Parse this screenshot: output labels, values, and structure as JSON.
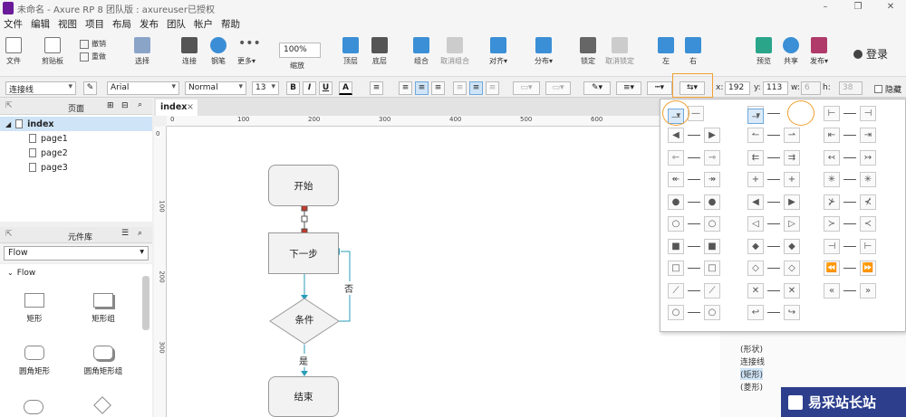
{
  "window": {
    "title": "未命名 - Axure RP 8 团队版 : axureuser已授权",
    "min": "–",
    "restore": "❐",
    "close": "✕"
  },
  "menu": [
    "文件",
    "编辑",
    "视图",
    "项目",
    "布局",
    "发布",
    "团队",
    "帐户",
    "帮助"
  ],
  "toolbar": {
    "file": "文件",
    "clipboard": "剪贴板",
    "undo": "撤销",
    "redo": "重做",
    "select": "选择",
    "connect": "连接",
    "pen": "钢笔",
    "more": "更多▾",
    "zoom": "100%",
    "zoom_label": "缩放",
    "top": "顶层",
    "bottom": "底层",
    "group": "组合",
    "ungroup": "取消组合",
    "align": "对齐▾",
    "distribute": "分布▾",
    "lock": "锁定",
    "unlock": "取消锁定",
    "left": "左",
    "right": "右",
    "preview": "预览",
    "share": "共享",
    "publish": "发布▾",
    "login": "登录"
  },
  "format": {
    "style": "连接线",
    "font": "Arial",
    "weight": "Normal",
    "size": "13",
    "bold": "B",
    "italic": "I",
    "underline": "U",
    "font_color": "A",
    "x_label": "x:",
    "x": "192",
    "y_label": "y:",
    "y": "113",
    "w_label": "w:",
    "w": "6",
    "h_label": "h:",
    "h": "38",
    "hidden": "隐藏"
  },
  "pages_panel": {
    "title": "页面",
    "items": [
      {
        "label": "index"
      },
      {
        "label": "page1"
      },
      {
        "label": "page2"
      },
      {
        "label": "page3"
      }
    ]
  },
  "library_panel": {
    "title": "元件库",
    "selected": "Flow",
    "section": "Flow",
    "items": [
      {
        "label": "矩形"
      },
      {
        "label": "矩形组"
      },
      {
        "label": "圆角矩形"
      },
      {
        "label": "圆角矩形组"
      }
    ]
  },
  "canvas": {
    "tab": "index",
    "ruler_h": [
      "0",
      "100",
      "200",
      "300",
      "400",
      "500",
      "600"
    ],
    "ruler_v": [
      "0",
      "100",
      "200",
      "300"
    ],
    "nodes": {
      "start": "开始",
      "next": "下一步",
      "cond": "条件",
      "end": "结束"
    },
    "labels": {
      "no": "否",
      "yes": "是"
    }
  },
  "arrow_popup": {
    "rows": [
      [
        "—",
        "—",
        "←",
        "→",
        "⊢",
        "⊣"
      ],
      [
        "◀",
        "▶",
        "↼",
        "⇀",
        "⇤",
        "⇥"
      ],
      [
        "⇽",
        "⇾",
        "⇇",
        "⇉",
        "↢",
        "↣"
      ],
      [
        "↞",
        "↠",
        "+",
        "+",
        "✳",
        "✳"
      ],
      [
        "●",
        "●",
        "◀",
        "▶",
        "⊁",
        "⊀"
      ],
      [
        "○",
        "○",
        "◁",
        "▷",
        "≻",
        "≺"
      ],
      [
        "■",
        "■",
        "◆",
        "◆",
        "⊣",
        "⊢"
      ],
      [
        "□",
        "□",
        "◇",
        "◇",
        "⏪",
        "⏩"
      ],
      [
        "⟋",
        "⟋",
        "✕",
        "✕",
        "«",
        "»"
      ],
      [
        "○",
        "○",
        "↩",
        "↪",
        "",
        ""
      ]
    ]
  },
  "outline": {
    "items": [
      "(形状)",
      "连接线",
      "(矩形)",
      "(菱形)"
    ]
  },
  "watermark": "易采站长站",
  "colors": {
    "highlight": "#f0a030",
    "accent": "#6fa8dc",
    "selected_row": "#cfe4f7"
  }
}
